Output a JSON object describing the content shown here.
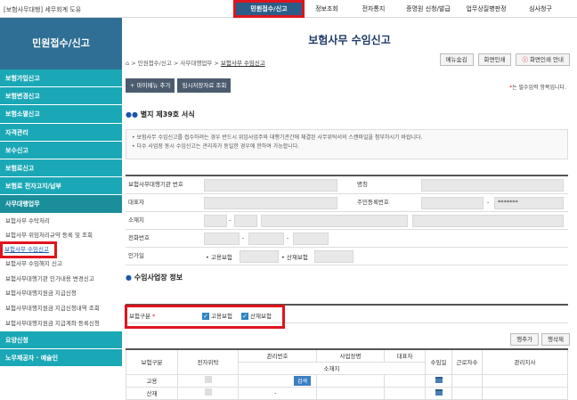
{
  "top": {
    "org": "[보험사무대행] 세무회계 도유",
    "nav": [
      "민원접수/신고",
      "정보조회",
      "전자통지",
      "증명원 신청/발급",
      "업무상질병판정",
      "심사청구"
    ]
  },
  "sidebar": {
    "head": "민원접수/신고",
    "categories": [
      "보험가입신고",
      "보험변경신고",
      "보험소멸신고",
      "자격관리",
      "보수신고",
      "보험료신고",
      "보험료 전자고지/납부",
      "사무대행업무"
    ],
    "subitems": [
      "보험사무 수탁처리",
      "보험사무 위임처리규약 등록 및 조회",
      "보험사무 수임신고",
      "보험사무 수임해지 신고",
      "보험사무대행기관 인가내용 변경신고",
      "보험사무대행지원금 지급신청",
      "보험사무대행지원금 지급신청내역 조회",
      "보험사무대행지원금 지급계좌 등록신청"
    ],
    "bottom": [
      "요양신청",
      "노무제공자 · 예술인"
    ]
  },
  "main": {
    "title": "보험사무 수임신고",
    "breadcrumb": [
      "민원접수/신고",
      "사무대행업무",
      "보험사무 수임신고"
    ],
    "buttons": {
      "menu_hide": "메뉴숨김",
      "print": "화면인쇄",
      "print_guide": "화면인쇄 안내"
    },
    "actions": {
      "add_menu": "+ 마이메뉴 추가",
      "temp_load": "임시저장자료 조회"
    },
    "required_note": "는 필수입력 항목입니다.",
    "section1": "별지 제39호 서식",
    "notices": [
      "보험사무 수임신고를 접수하려는 경우 반드시 위임사업주와 대행기관간에 체결된 사무위탁서의 스캔파일을 첨부하시기 바랍니다.",
      "다수 사업장 동시 수임신고는 관리자가 동일한 경우에 한하여 가능합니다."
    ],
    "form": {
      "agency_no": "보험사무대행기관 번호",
      "name": "명칭",
      "rep": "대표자",
      "rrn": "주민등록번호",
      "rrn_mask": "*******",
      "addr": "소재지",
      "phone": "전화번호",
      "approval": "인가일",
      "emp_ins": "고용보험",
      "ind_ins": "산재보험"
    },
    "section2": "수임사업장 정보",
    "biz": {
      "label": "보험구분",
      "opt1": "고용보험",
      "opt2": "산재보험"
    },
    "table_buttons": {
      "add_row": "행추가",
      "del_row": "행삭제"
    },
    "table": {
      "headers": [
        "보험구분",
        "전자위탁",
        "관리번호",
        "사업장명",
        "대표자",
        "수임일",
        "근로자수",
        "관리지사"
      ],
      "sub_header": "소재지",
      "rows": [
        "고용",
        "산재"
      ],
      "search": "검색"
    }
  }
}
